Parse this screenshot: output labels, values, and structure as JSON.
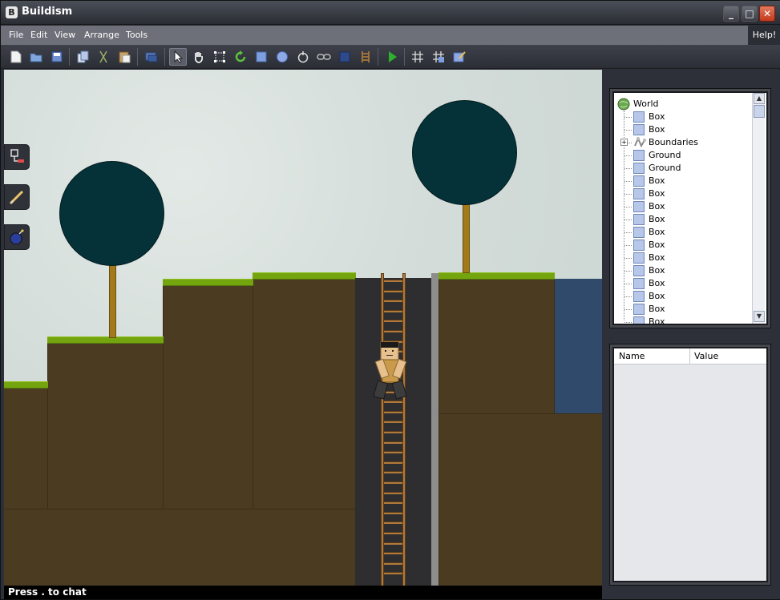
{
  "app": {
    "title": "Buildism",
    "logo_letter": "B"
  },
  "window_controls": {
    "minimize": "_",
    "maximize": "□",
    "close": "✕"
  },
  "menu": {
    "items": [
      "File",
      "Edit",
      "View",
      "Arrange",
      "Tools"
    ],
    "help": "Help!"
  },
  "toolbar": {
    "tools": [
      {
        "name": "new-file-icon"
      },
      {
        "name": "open-folder-icon"
      },
      {
        "name": "save-icon"
      },
      {
        "name": "copy-icon"
      },
      {
        "name": "cut-icon"
      },
      {
        "name": "paste-icon"
      },
      {
        "name": "layer-icon"
      },
      {
        "name": "select-arrow-icon",
        "active": true
      },
      {
        "name": "pan-hand-icon"
      },
      {
        "name": "resize-icon"
      },
      {
        "name": "rotate-icon"
      },
      {
        "name": "box-tool-icon"
      },
      {
        "name": "circle-tool-icon"
      },
      {
        "name": "spin-tool-icon"
      },
      {
        "name": "link-tool-icon"
      },
      {
        "name": "block-tool-icon"
      },
      {
        "name": "ladder-tool-icon"
      },
      {
        "name": "play-icon"
      },
      {
        "name": "grid-icon"
      },
      {
        "name": "snap-grid-icon"
      },
      {
        "name": "edit-note-icon"
      }
    ]
  },
  "side_tools": [
    {
      "name": "plug-tool-icon"
    },
    {
      "name": "pencil-tool-icon"
    },
    {
      "name": "bomb-tool-icon"
    }
  ],
  "status": {
    "text": "Press . to chat"
  },
  "tree": {
    "root": "World",
    "expander": "+",
    "items": [
      "Box",
      "Box",
      "Boundaries",
      "Ground",
      "Ground",
      "Box",
      "Box",
      "Box",
      "Box",
      "Box",
      "Box",
      "Box",
      "Box",
      "Box",
      "Box",
      "Box",
      "Box"
    ],
    "scroll_up": "▲",
    "scroll_down": "▼"
  },
  "properties": {
    "columns": [
      "Name",
      "Value"
    ]
  },
  "colors": {
    "grass": "#74a50f",
    "dirt": "#4b3b21",
    "treetop": "#043238",
    "trunk": "#a37a1a",
    "water": "#2f4a6a",
    "shaft": "#2e2e30",
    "play_green": "#2db02d"
  }
}
